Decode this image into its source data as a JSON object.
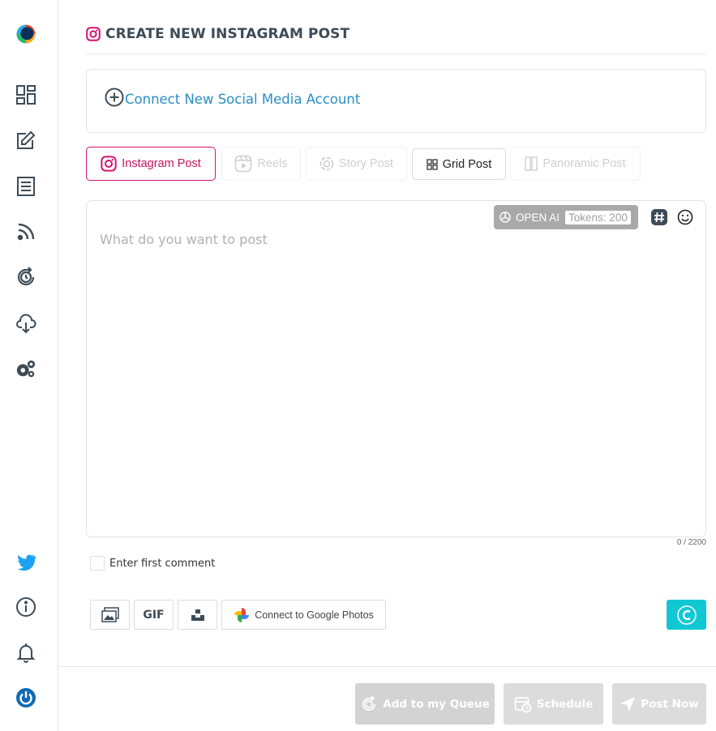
{
  "sidebar": {
    "logo": "app-logo",
    "items": [
      {
        "name": "dashboard-icon"
      },
      {
        "name": "compose-icon"
      },
      {
        "name": "posts-list-icon"
      },
      {
        "name": "rss-feed-icon"
      },
      {
        "name": "history-sync-icon"
      },
      {
        "name": "cloud-download-icon"
      },
      {
        "name": "settings-gears-icon"
      }
    ],
    "bottom_items": [
      {
        "name": "twitter-icon"
      },
      {
        "name": "info-icon"
      },
      {
        "name": "notifications-bell-icon"
      },
      {
        "name": "power-icon"
      }
    ]
  },
  "page": {
    "title": "CREATE NEW INSTAGRAM POST"
  },
  "connect": {
    "label": "Connect New Social Media Account"
  },
  "tabs": [
    {
      "label": "Instagram Post",
      "state": "active"
    },
    {
      "label": "Reels",
      "state": "disabled"
    },
    {
      "label": "Story Post",
      "state": "disabled"
    },
    {
      "label": "Grid Post",
      "state": "normal"
    },
    {
      "label": "Panoramic Post",
      "state": "disabled"
    }
  ],
  "editor": {
    "placeholder": "What do you want to post",
    "openai_label": "OPEN AI",
    "tokens_label": "Tokens: 200",
    "counter": "0 / 2200"
  },
  "comment": {
    "label": "Enter first comment",
    "checked": false
  },
  "media": {
    "gif_label": "GIF",
    "google_photos_label": "Connect to Google Photos"
  },
  "footer": {
    "queue_label": "Add to my Queue",
    "schedule_label": "Schedule",
    "post_now_label": "Post Now"
  },
  "colors": {
    "instagram_accent": "#c5135f",
    "link_blue": "#2a8ec5",
    "canva_teal": "#10c8d4",
    "disabled_gray": "#d3d3d3",
    "sidebar_icon": "#3d4b57",
    "twitter_blue": "#1da1f2",
    "power_blue": "#0f6ab4"
  }
}
